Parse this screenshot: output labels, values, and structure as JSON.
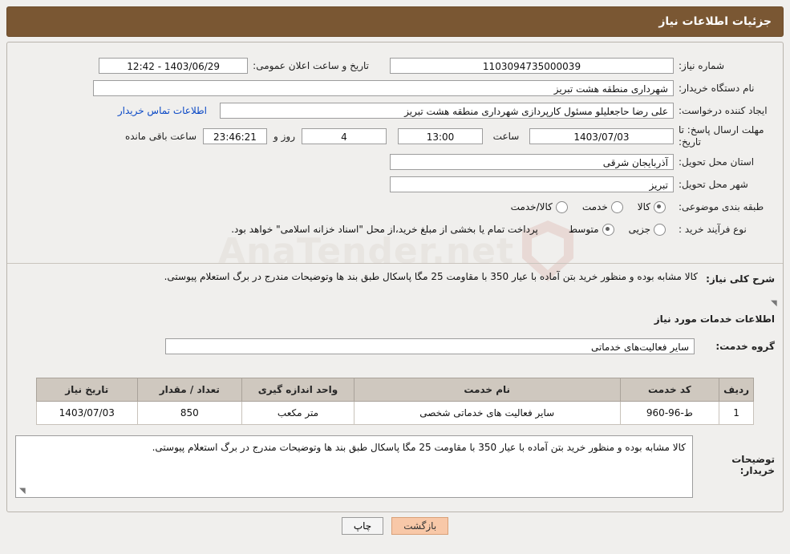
{
  "header": {
    "title": "جزئیات اطلاعات نیاز"
  },
  "watermark": {
    "text": "AnaTender.net"
  },
  "form": {
    "need_number": {
      "label": "شماره نیاز:",
      "value": "1103094735000039"
    },
    "public_announce": {
      "label": "تاریخ و ساعت اعلان عمومی:",
      "value": "1403/06/29 - 12:42"
    },
    "buyer_org": {
      "label": "نام دستگاه خریدار:",
      "value": "شهرداری منطقه هشت تبریز"
    },
    "requester": {
      "label": "ایجاد کننده درخواست:",
      "value": "علی رضا حاجعلیلو مسئول کارپردازی شهرداری منطقه هشت تبریز"
    },
    "contact_link": {
      "label": "اطلاعات تماس خریدار"
    },
    "deadline": {
      "label": "مهلت ارسال پاسخ: تا تاریخ:",
      "date": "1403/07/03",
      "time_label": "ساعت",
      "time": "13:00",
      "days": "4",
      "days_label": "روز و",
      "remaining": "23:46:21",
      "remaining_label": "ساعت باقی مانده"
    },
    "province": {
      "label": "استان محل تحویل:",
      "value": "آذربایجان شرقی"
    },
    "city": {
      "label": "شهر محل تحویل:",
      "value": "تبریز"
    },
    "category": {
      "label": "طبقه بندی موضوعی:",
      "options": [
        {
          "text": "کالا",
          "selected": true
        },
        {
          "text": "خدمت",
          "selected": false
        },
        {
          "text": "کالا/خدمت",
          "selected": false
        }
      ]
    },
    "purchase_type": {
      "label": "نوع فرآیند خرید :",
      "options": [
        {
          "text": "جزیی",
          "selected": false
        },
        {
          "text": "متوسط",
          "selected": true
        }
      ],
      "note": "پرداخت تمام یا بخشی از مبلغ خرید،از محل \"اسناد خزانه اسلامی\" خواهد بود."
    }
  },
  "general_desc": {
    "label": "شرح کلی نیاز:",
    "text": "کالا مشابه بوده و منظور خرید بتن آماده با عیار 350 با مقاومت 25 مگا پاسکال طبق بند ها وتوضیحات مندرج در برگ استعلام پیوستی."
  },
  "services_section": {
    "title": "اطلاعات خدمات مورد نیاز"
  },
  "service_group": {
    "label": "گروه خدمت:",
    "value": "سایر فعالیت‌های خدماتی"
  },
  "table": {
    "headers": [
      "ردیف",
      "کد خدمت",
      "نام خدمت",
      "واحد اندازه گیری",
      "تعداد / مقدار",
      "تاریخ نیاز"
    ],
    "rows": [
      [
        "1",
        "ط-96-960",
        "سایر فعالیت های خدماتی شخصی",
        "متر مکعب",
        "850",
        "1403/07/03"
      ]
    ]
  },
  "buyer_notes": {
    "label": "توضیحات خریدار:",
    "text": "کالا مشابه بوده و منظور خرید بتن آماده با عیار 350 با مقاومت 25 مگا پاسکال طبق بند ها وتوضیحات مندرج در برگ استعلام پیوستی."
  },
  "footer": {
    "print_label": "چاپ",
    "back_label": "بازگشت"
  }
}
